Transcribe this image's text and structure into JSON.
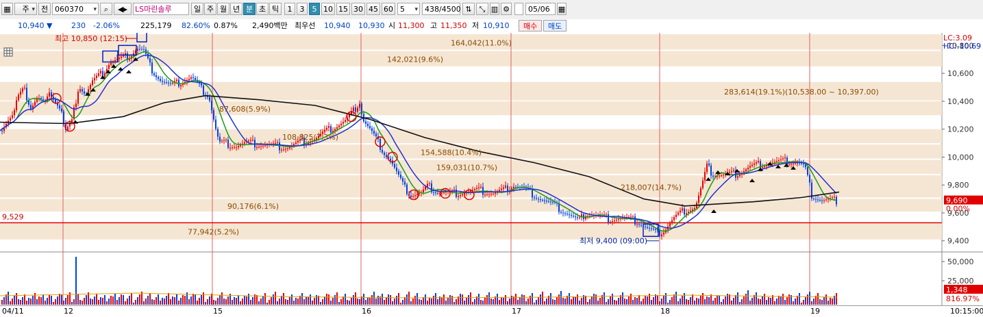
{
  "toolbar": {
    "market": "주",
    "range_btn": "전",
    "code": "060370",
    "stock_name": "LS마린솔루",
    "period_buttons": [
      "일",
      "주",
      "월",
      "년",
      "분",
      "초",
      "틱"
    ],
    "minute_buttons": [
      "1",
      "3",
      "5",
      "10",
      "15",
      "30",
      "45",
      "60"
    ],
    "interval": "5",
    "count": "438/4500",
    "date": "05/06"
  },
  "info": {
    "price": "10,940 ▼",
    "change": "230",
    "change_pct": "-2.06%",
    "volume": "225,179",
    "vol_ratio": "82.60%",
    "turnover_pct": "0.87%",
    "amount": "2,490백만",
    "best_label": "최우선",
    "ask": "10,940",
    "bid": "10,930",
    "open_label": "시",
    "open": "11,300",
    "high_label": "고",
    "high": "11,350",
    "low_label": "저",
    "low": "10,910",
    "buy_btn": "매수",
    "sell_btn": "매도"
  },
  "colors": {
    "up": "#e00000",
    "down": "#0040e0",
    "ma_short": "#1a9a1a",
    "ma_mid": "#2030d0",
    "ma_long": "#101010",
    "volume_profile": "#f5e6d3",
    "hline": "#e00000"
  },
  "chart_data": {
    "type": "candlestick",
    "y_axis_price": {
      "ticks": [
        "10,800",
        "10,600",
        "10,400",
        "10,200",
        "10,000",
        "9,800",
        "9,600",
        "9,400"
      ],
      "range": [
        9330,
        10890
      ]
    },
    "y_axis_volume": {
      "ticks": [
        "50,000",
        "25,000"
      ]
    },
    "x_axis": {
      "dates": [
        "04/11",
        "12",
        "15",
        "16",
        "17",
        "18",
        "19"
      ],
      "time": "10:15:00"
    },
    "top_right": [
      "LC:3.09",
      "HC:-10.69"
    ],
    "last_price_label": "9,690",
    "last_pct_label": "0.00%",
    "last_vol_label": "1,348",
    "last_vol_pct_label": "816.97%",
    "high_annotation": "최고 10,850 (12:15)",
    "low_annotation": "최저 9,400 (09:00)",
    "hline": {
      "label": "9,529",
      "value": 9529
    },
    "volume_profile": [
      {
        "label": "164,042(11.0%)",
        "low": 10760,
        "high": 10880
      },
      {
        "label": "142,021(9.6%)",
        "low": 10640,
        "high": 10760
      },
      {
        "label": "283,614(19.1%)(10,538.00 ~ 10,397.00)",
        "low": 10397,
        "high": 10538
      },
      {
        "label": "87,608(5.9%)",
        "low": 10290,
        "high": 10400
      },
      {
        "label": "108,825(7.3%)",
        "low": 10090,
        "high": 10200
      },
      {
        "label": "154,588(10.4%)",
        "low": 9980,
        "high": 10090
      },
      {
        "label": "159,031(10.7%)",
        "low": 9870,
        "high": 9980
      },
      {
        "label": "218,007(14.7%)",
        "low": 9700,
        "high": 9870
      },
      {
        "label": "90,176(6.1%)",
        "low": 9600,
        "high": 9700
      },
      {
        "label": "77,942(5.2%)",
        "low": 9400,
        "high": 9530
      }
    ],
    "price_path": [
      [
        0,
        10190
      ],
      [
        10,
        10260
      ],
      [
        20,
        10310
      ],
      [
        25,
        10420
      ],
      [
        35,
        10480
      ],
      [
        45,
        10360
      ],
      [
        55,
        10430
      ],
      [
        65,
        10380
      ],
      [
        75,
        10460
      ],
      [
        90,
        10330
      ],
      [
        95,
        10180
      ],
      [
        105,
        10250
      ],
      [
        115,
        10520
      ],
      [
        125,
        10450
      ],
      [
        135,
        10540
      ],
      [
        150,
        10600
      ],
      [
        160,
        10680
      ],
      [
        175,
        10700
      ],
      [
        190,
        10730
      ],
      [
        200,
        10780
      ],
      [
        210,
        10760
      ],
      [
        220,
        10640
      ],
      [
        235,
        10550
      ],
      [
        250,
        10510
      ],
      [
        265,
        10540
      ],
      [
        280,
        10570
      ],
      [
        295,
        10480
      ],
      [
        305,
        10440
      ],
      [
        315,
        10200
      ],
      [
        320,
        10100
      ],
      [
        330,
        10100
      ],
      [
        345,
        10080
      ],
      [
        360,
        10100
      ],
      [
        380,
        10090
      ],
      [
        400,
        10080
      ],
      [
        420,
        10070
      ],
      [
        440,
        10110
      ],
      [
        460,
        10130
      ],
      [
        475,
        10180
      ],
      [
        490,
        10220
      ],
      [
        505,
        10260
      ],
      [
        515,
        10320
      ],
      [
        525,
        10400
      ],
      [
        530,
        10270
      ],
      [
        540,
        10200
      ],
      [
        550,
        10120
      ],
      [
        560,
        10040
      ],
      [
        570,
        9980
      ],
      [
        580,
        9880
      ],
      [
        590,
        9780
      ],
      [
        600,
        9730
      ],
      [
        615,
        9740
      ],
      [
        625,
        9790
      ],
      [
        640,
        9750
      ],
      [
        660,
        9740
      ],
      [
        680,
        9750
      ],
      [
        700,
        9760
      ],
      [
        720,
        9740
      ],
      [
        735,
        9760
      ],
      [
        750,
        9800
      ],
      [
        770,
        9760
      ],
      [
        790,
        9700
      ],
      [
        810,
        9650
      ],
      [
        830,
        9590
      ],
      [
        845,
        9540
      ],
      [
        855,
        9600
      ],
      [
        870,
        9580
      ],
      [
        890,
        9560
      ],
      [
        910,
        9560
      ],
      [
        930,
        9540
      ],
      [
        945,
        9490
      ],
      [
        960,
        9450
      ],
      [
        970,
        9480
      ],
      [
        985,
        9570
      ],
      [
        1000,
        9620
      ],
      [
        1015,
        9640
      ],
      [
        1025,
        9800
      ],
      [
        1032,
        9930
      ],
      [
        1040,
        9880
      ],
      [
        1055,
        9870
      ],
      [
        1075,
        9880
      ],
      [
        1095,
        9930
      ],
      [
        1110,
        9950
      ],
      [
        1130,
        9960
      ],
      [
        1150,
        9970
      ],
      [
        1165,
        9960
      ],
      [
        1175,
        9930
      ],
      [
        1185,
        9730
      ],
      [
        1200,
        9690
      ],
      [
        1222,
        9690
      ]
    ],
    "ma_long": [
      [
        0,
        10250
      ],
      [
        100,
        10240
      ],
      [
        180,
        10290
      ],
      [
        240,
        10390
      ],
      [
        300,
        10440
      ],
      [
        380,
        10410
      ],
      [
        460,
        10370
      ],
      [
        540,
        10270
      ],
      [
        620,
        10140
      ],
      [
        700,
        10040
      ],
      [
        780,
        9960
      ],
      [
        860,
        9860
      ],
      [
        940,
        9700
      ],
      [
        1000,
        9650
      ],
      [
        1100,
        9680
      ],
      [
        1170,
        9710
      ],
      [
        1225,
        9750
      ]
    ]
  }
}
